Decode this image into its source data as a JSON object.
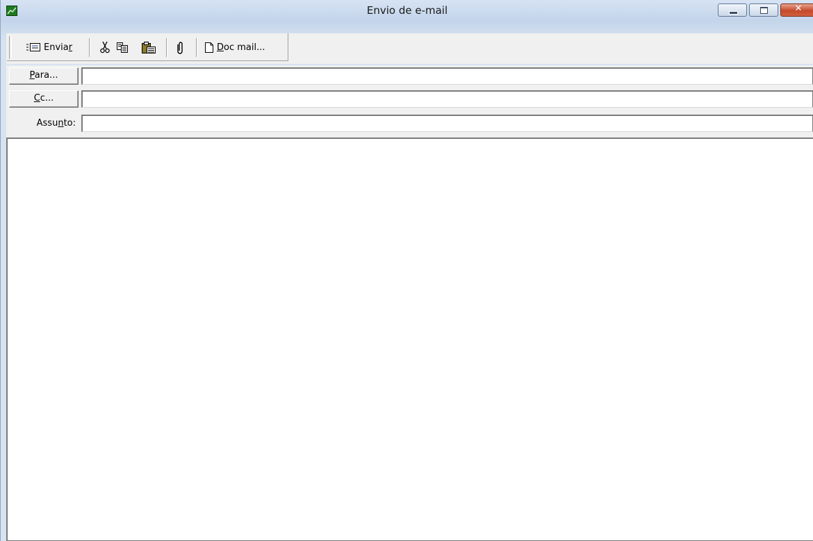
{
  "window": {
    "title": "Envio de e-mail",
    "close_glyph": "✕"
  },
  "toolbar": {
    "send_label_main": "Envia",
    "send_label_accel": "r",
    "cut_icon": "scissors-icon",
    "copy_icon": "copy-icon",
    "paste_icon": "paste-icon",
    "attach_icon": "paperclip-icon",
    "docmail_label_accel": "D",
    "docmail_label_rest": "oc mail..."
  },
  "fields": {
    "to_label_accel": "P",
    "to_label_rest": "ara...",
    "to_value": "",
    "cc_label_accel": "C",
    "cc_label_rest": "c...",
    "cc_value": "",
    "subject_label_pre": "Assu",
    "subject_label_accel": "n",
    "subject_label_post": "to:",
    "subject_value": ""
  },
  "message": {
    "body": ""
  },
  "colors": {
    "app_icon": "#1f7a1f",
    "close_button": "#c44a2b",
    "field_background": "#ffffff"
  }
}
